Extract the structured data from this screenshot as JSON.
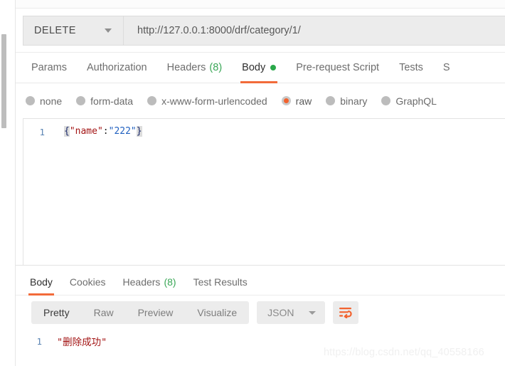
{
  "request": {
    "method": "DELETE",
    "url": "http://127.0.0.1:8000/drf/category/1/",
    "tabs": [
      {
        "label": "Params",
        "active": false
      },
      {
        "label": "Authorization",
        "active": false
      },
      {
        "label": "Headers",
        "count": "(8)",
        "active": false
      },
      {
        "label": "Body",
        "active": true
      },
      {
        "label": "Pre-request Script",
        "active": false
      },
      {
        "label": "Tests",
        "active": false
      },
      {
        "label": "S",
        "active": false
      }
    ],
    "body_types": [
      {
        "label": "none",
        "selected": false
      },
      {
        "label": "form-data",
        "selected": false
      },
      {
        "label": "x-www-form-urlencoded",
        "selected": false
      },
      {
        "label": "raw",
        "selected": true
      },
      {
        "label": "binary",
        "selected": false
      },
      {
        "label": "GraphQL",
        "selected": false
      }
    ],
    "editor": {
      "line_number": "1",
      "tokens": {
        "open_brace": "{",
        "key": "\"name\"",
        "colon": ":",
        "value": "\"222\"",
        "close_brace": "}"
      }
    }
  },
  "response": {
    "tabs": [
      {
        "label": "Body",
        "active": true
      },
      {
        "label": "Cookies",
        "active": false
      },
      {
        "label": "Headers",
        "count": "(8)",
        "active": false
      },
      {
        "label": "Test Results",
        "active": false
      }
    ],
    "view_modes": [
      {
        "label": "Pretty",
        "active": true
      },
      {
        "label": "Raw",
        "active": false
      },
      {
        "label": "Preview",
        "active": false
      },
      {
        "label": "Visualize",
        "active": false
      }
    ],
    "format": "JSON",
    "wrap_icon": "word-wrap-icon",
    "body": {
      "line_number": "1",
      "text": "\"删除成功\""
    }
  },
  "watermark": "https://blog.csdn.net/qq_40558166",
  "colors": {
    "accent": "#f26b3a",
    "green": "#2aa84a",
    "count_green": "#3aa757",
    "control_bg": "#ececec"
  }
}
